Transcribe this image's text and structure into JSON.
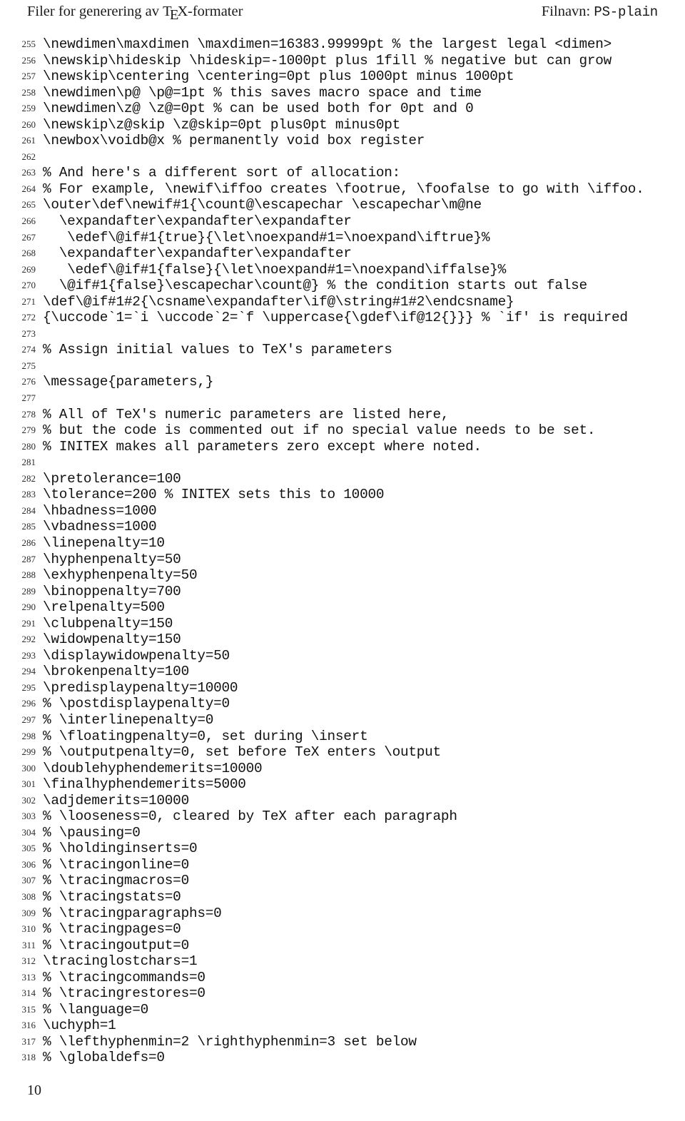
{
  "header": {
    "left_prefix": "Filer for generering av ",
    "tex_logo": {
      "t": "T",
      "e": "E",
      "x": "X"
    },
    "left_suffix": "-formater",
    "left_full": "Filer for generering av TeX-formater",
    "right_label": "Filnavn:",
    "right_filename": "PS-plain"
  },
  "footer": {
    "page_number": "10"
  },
  "listing": {
    "first_line_number": 255,
    "last_line_number": 318,
    "lines": [
      {
        "n": "255",
        "text": "\\newdimen\\maxdimen \\maxdimen=16383.99999pt % the largest legal <dimen>"
      },
      {
        "n": "256",
        "text": "\\newskip\\hideskip \\hideskip=-1000pt plus 1fill % negative but can grow"
      },
      {
        "n": "257",
        "text": "\\newskip\\centering \\centering=0pt plus 1000pt minus 1000pt"
      },
      {
        "n": "258",
        "text": "\\newdimen\\p@ \\p@=1pt % this saves macro space and time"
      },
      {
        "n": "259",
        "text": "\\newdimen\\z@ \\z@=0pt % can be used both for 0pt and 0"
      },
      {
        "n": "260",
        "text": "\\newskip\\z@skip \\z@skip=0pt plus0pt minus0pt"
      },
      {
        "n": "261",
        "text": "\\newbox\\voidb@x % permanently void box register"
      },
      {
        "n": "262",
        "text": ""
      },
      {
        "n": "263",
        "text": "% And here's a different sort of allocation:"
      },
      {
        "n": "264",
        "text": "% For example, \\newif\\iffoo creates \\footrue, \\foofalse to go with \\iffoo."
      },
      {
        "n": "265",
        "text": "\\outer\\def\\newif#1{\\count@\\escapechar \\escapechar\\m@ne"
      },
      {
        "n": "266",
        "text": "  \\expandafter\\expandafter\\expandafter"
      },
      {
        "n": "267",
        "text": "   \\edef\\@if#1{true}{\\let\\noexpand#1=\\noexpand\\iftrue}%"
      },
      {
        "n": "268",
        "text": "  \\expandafter\\expandafter\\expandafter"
      },
      {
        "n": "269",
        "text": "   \\edef\\@if#1{false}{\\let\\noexpand#1=\\noexpand\\iffalse}%"
      },
      {
        "n": "270",
        "text": "  \\@if#1{false}\\escapechar\\count@} % the condition starts out false"
      },
      {
        "n": "271",
        "text": "\\def\\@if#1#2{\\csname\\expandafter\\if@\\string#1#2\\endcsname}"
      },
      {
        "n": "272",
        "text": "{\\uccode`1=`i \\uccode`2=`f \\uppercase{\\gdef\\if@12{}}} % `if' is required"
      },
      {
        "n": "273",
        "text": ""
      },
      {
        "n": "274",
        "text": "% Assign initial values to TeX's parameters"
      },
      {
        "n": "275",
        "text": ""
      },
      {
        "n": "276",
        "text": "\\message{parameters,}"
      },
      {
        "n": "277",
        "text": ""
      },
      {
        "n": "278",
        "text": "% All of TeX's numeric parameters are listed here,"
      },
      {
        "n": "279",
        "text": "% but the code is commented out if no special value needs to be set."
      },
      {
        "n": "280",
        "text": "% INITEX makes all parameters zero except where noted."
      },
      {
        "n": "281",
        "text": ""
      },
      {
        "n": "282",
        "text": "\\pretolerance=100"
      },
      {
        "n": "283",
        "text": "\\tolerance=200 % INITEX sets this to 10000"
      },
      {
        "n": "284",
        "text": "\\hbadness=1000"
      },
      {
        "n": "285",
        "text": "\\vbadness=1000"
      },
      {
        "n": "286",
        "text": "\\linepenalty=10"
      },
      {
        "n": "287",
        "text": "\\hyphenpenalty=50"
      },
      {
        "n": "288",
        "text": "\\exhyphenpenalty=50"
      },
      {
        "n": "289",
        "text": "\\binoppenalty=700"
      },
      {
        "n": "290",
        "text": "\\relpenalty=500"
      },
      {
        "n": "291",
        "text": "\\clubpenalty=150"
      },
      {
        "n": "292",
        "text": "\\widowpenalty=150"
      },
      {
        "n": "293",
        "text": "\\displaywidowpenalty=50"
      },
      {
        "n": "294",
        "text": "\\brokenpenalty=100"
      },
      {
        "n": "295",
        "text": "\\predisplaypenalty=10000"
      },
      {
        "n": "296",
        "text": "% \\postdisplaypenalty=0"
      },
      {
        "n": "297",
        "text": "% \\interlinepenalty=0"
      },
      {
        "n": "298",
        "text": "% \\floatingpenalty=0, set during \\insert"
      },
      {
        "n": "299",
        "text": "% \\outputpenalty=0, set before TeX enters \\output"
      },
      {
        "n": "300",
        "text": "\\doublehyphendemerits=10000"
      },
      {
        "n": "301",
        "text": "\\finalhyphendemerits=5000"
      },
      {
        "n": "302",
        "text": "\\adjdemerits=10000"
      },
      {
        "n": "303",
        "text": "% \\looseness=0, cleared by TeX after each paragraph"
      },
      {
        "n": "304",
        "text": "% \\pausing=0"
      },
      {
        "n": "305",
        "text": "% \\holdinginserts=0"
      },
      {
        "n": "306",
        "text": "% \\tracingonline=0"
      },
      {
        "n": "307",
        "text": "% \\tracingmacros=0"
      },
      {
        "n": "308",
        "text": "% \\tracingstats=0"
      },
      {
        "n": "309",
        "text": "% \\tracingparagraphs=0"
      },
      {
        "n": "310",
        "text": "% \\tracingpages=0"
      },
      {
        "n": "311",
        "text": "% \\tracingoutput=0"
      },
      {
        "n": "312",
        "text": "\\tracinglostchars=1"
      },
      {
        "n": "313",
        "text": "% \\tracingcommands=0"
      },
      {
        "n": "314",
        "text": "% \\tracingrestores=0"
      },
      {
        "n": "315",
        "text": "% \\language=0"
      },
      {
        "n": "316",
        "text": "\\uchyph=1"
      },
      {
        "n": "317",
        "text": "% \\lefthyphenmin=2 \\righthyphenmin=3 set below"
      },
      {
        "n": "318",
        "text": "% \\globaldefs=0"
      }
    ]
  }
}
